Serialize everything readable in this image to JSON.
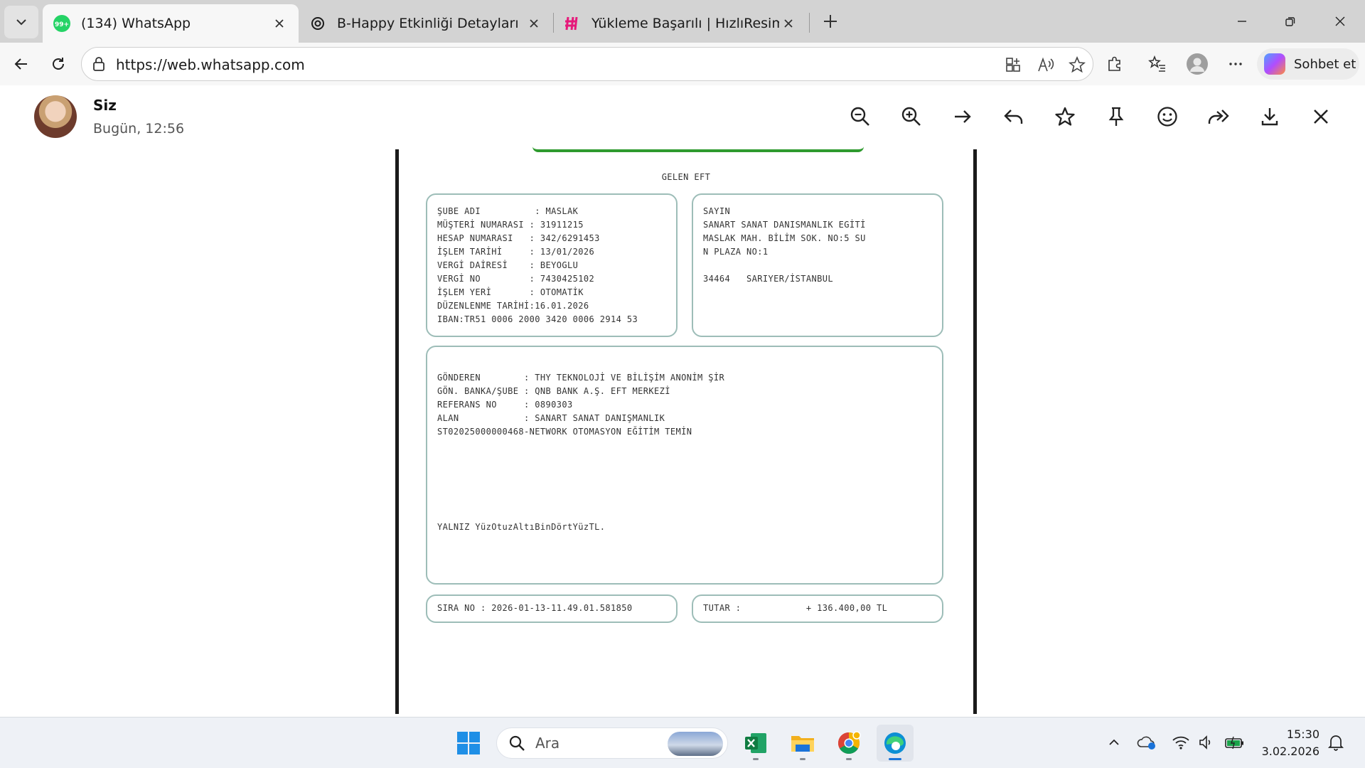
{
  "browser": {
    "tabs": [
      {
        "title": "(134) WhatsApp",
        "badge": "99+",
        "favicon": "whatsapp-icon",
        "active": true
      },
      {
        "title": "B-Happy Etkinliği Detayları",
        "favicon": "chatgpt-icon",
        "active": false
      },
      {
        "title": "Yükleme Başarılı | HızlıResim",
        "favicon": "hizliresim-icon",
        "active": false
      }
    ],
    "url": "https://web.whatsapp.com",
    "copilot_label": "Sohbet et"
  },
  "viewer": {
    "sender": "Siz",
    "time": "Bugün, 12:56",
    "actions": [
      "zoom-out",
      "zoom-in",
      "next",
      "reply",
      "star",
      "pin",
      "react",
      "forward",
      "download",
      "close"
    ]
  },
  "document": {
    "title": "GELEN EFT",
    "left_box": "ŞUBE ADI          : MASLAK\nMÜŞTERİ NUMARASI : 31911215\nHESAP NUMARASI   : 342/6291453\nİŞLEM TARİHİ     : 13/01/2026\nVERGİ DAİRESİ    : BEYOGLU\nVERGİ NO         : 7430425102\nİŞLEM YERİ       : OTOMATİK\nDÜZENLENME TARİHİ:16.01.2026\nIBAN:TR51 0006 2000 3420 0006 2914 53",
    "right_box": "SAYIN\nSANART SANAT DANISMANLIK EGİTİ\nMASLAK MAH. BİLİM SOK. NO:5 SU\nN PLAZA NO:1\n\n34464   SARIYER/İSTANBUL",
    "mid_box": "GÖNDEREN        : THY TEKNOLOJİ VE BİLİŞİM ANONİM ŞİR\nGÖN. BANKA/ŞUBE : QNB BANK A.Ş. EFT MERKEZİ\nREFERANS NO     : 0890303\nALAN            : SANART SANAT DANIŞMANLIK\nST02025000000468-NETWORK OTOMASYON EĞİTİM TEMİN",
    "amount_words": "YALNIZ YüzOtuzAltıBinDörtYüzTL.",
    "sequence": "SIRA NO : 2026-01-13-11.49.01.581850",
    "total": "TUTAR :            + 136.400,00 TL"
  },
  "taskbar": {
    "search_placeholder": "Ara",
    "apps": [
      "windows-start",
      "excel",
      "file-explorer",
      "chrome",
      "edge"
    ],
    "time": "15:30",
    "date": "3.02.2026"
  },
  "colors": {
    "doc_border": "#9dbdb8",
    "green_bar": "#2e9a2e",
    "whatsapp": "#25d366",
    "chatgpt": "#1b1b1b",
    "hizliresim": "#e6197a"
  }
}
